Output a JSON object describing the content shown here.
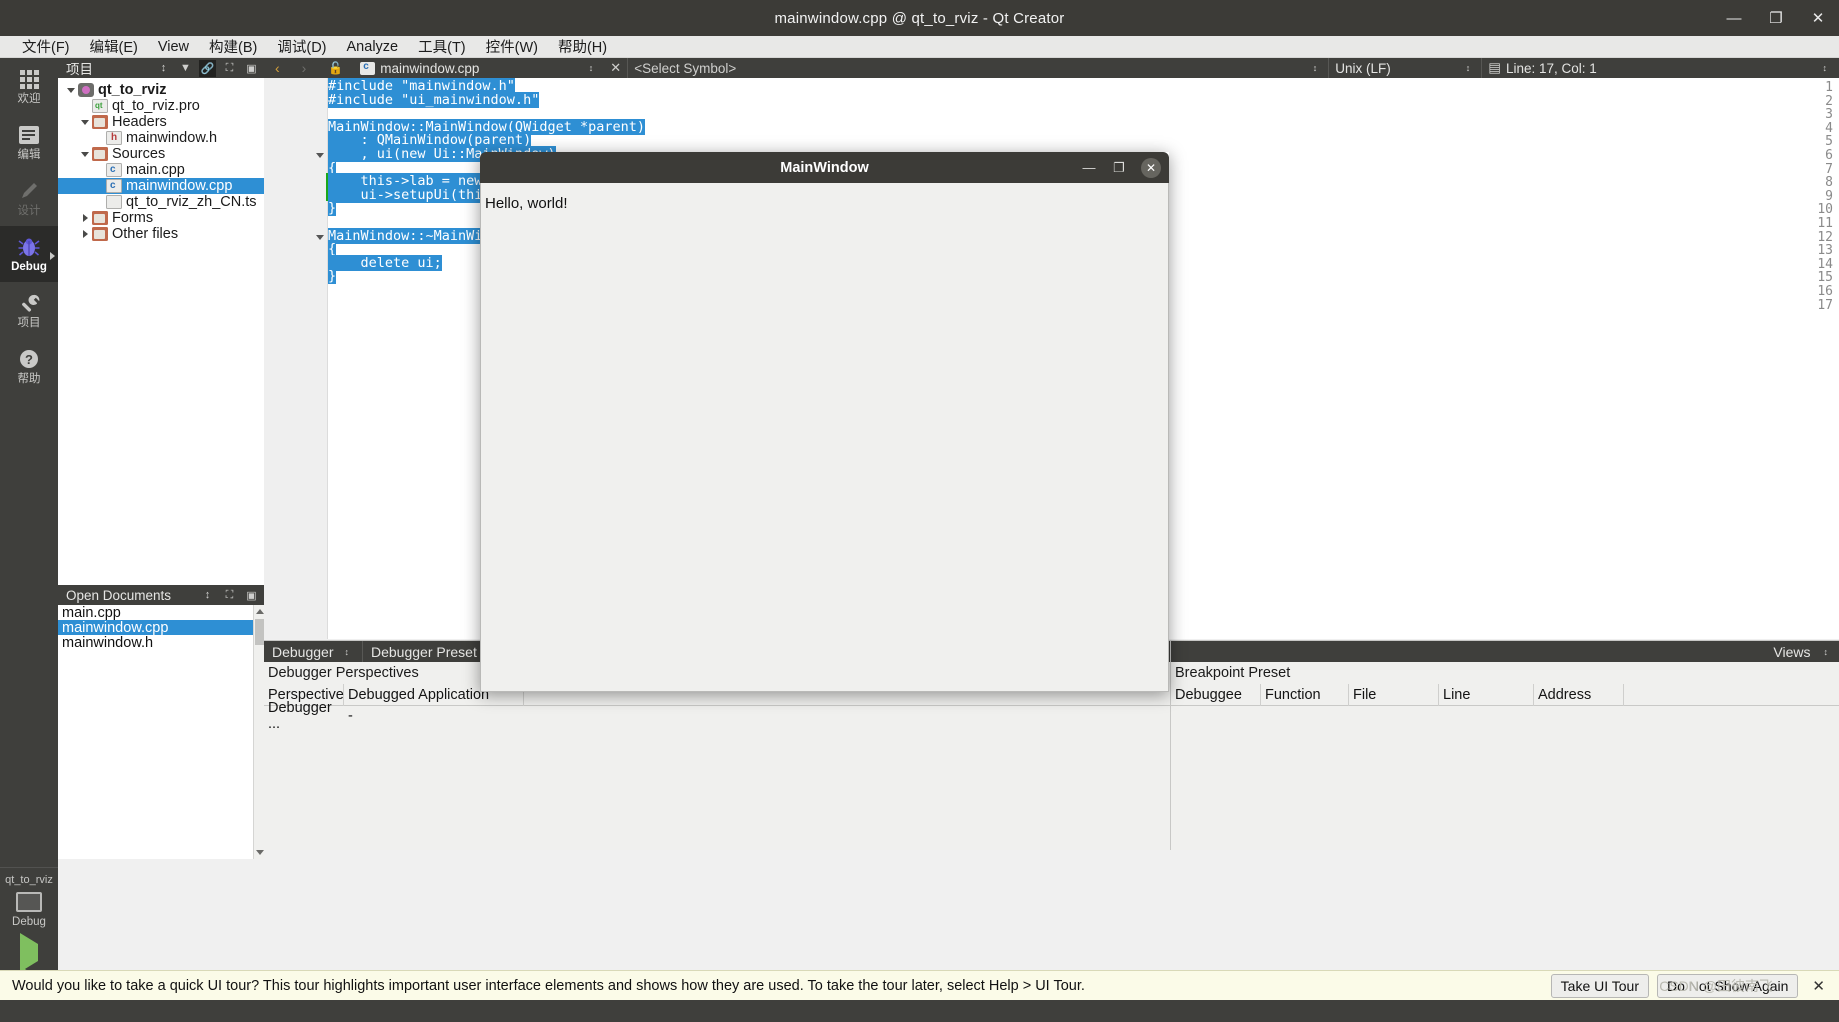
{
  "window": {
    "title": "mainwindow.cpp @ qt_to_rviz - Qt Creator",
    "minimize": "—",
    "maximize": "❐",
    "close": "✕"
  },
  "menubar": {
    "items": [
      {
        "label": "文件(F)",
        "mnemonic": "F"
      },
      {
        "label": "编辑(E)",
        "mnemonic": "E"
      },
      {
        "label": "View",
        "mnemonic": "V"
      },
      {
        "label": "构建(B)",
        "mnemonic": "B"
      },
      {
        "label": "调试(D)",
        "mnemonic": "D"
      },
      {
        "label": "Analyze",
        "mnemonic": "A"
      },
      {
        "label": "工具(T)",
        "mnemonic": "T"
      },
      {
        "label": "控件(W)",
        "mnemonic": "W"
      },
      {
        "label": "帮助(H)",
        "mnemonic": "H"
      }
    ]
  },
  "modebar": {
    "modes": [
      {
        "label": "欢迎",
        "icon": "grid-icon",
        "state": "normal"
      },
      {
        "label": "编辑",
        "icon": "editor-icon",
        "state": "normal"
      },
      {
        "label": "设计",
        "icon": "pencil-icon",
        "state": "disabled"
      },
      {
        "label": "Debug",
        "icon": "bug-icon",
        "state": "active"
      },
      {
        "label": "项目",
        "icon": "wrench-icon",
        "state": "normal"
      },
      {
        "label": "帮助",
        "icon": "question-icon",
        "state": "normal"
      }
    ],
    "kit": {
      "project": "qt_to_rviz",
      "build_config": "Debug"
    },
    "run_label": "run-button",
    "debug_label": "run-debug-button"
  },
  "project_panel": {
    "title": "项目",
    "tools": [
      "sort-toggle",
      "filter-icon",
      "link-with-editor-icon",
      "add-split-icon",
      "collapse-icon"
    ],
    "tree": [
      {
        "indent": 0,
        "twisty": "down",
        "icon": "proj",
        "label": "qt_to_rviz",
        "bold": true,
        "selected": false
      },
      {
        "indent": 1,
        "twisty": "none",
        "icon": "pro",
        "label": "qt_to_rviz.pro",
        "bold": false,
        "selected": false
      },
      {
        "indent": 1,
        "twisty": "down",
        "icon": "folder",
        "label": "Headers",
        "bold": false,
        "selected": false
      },
      {
        "indent": 2,
        "twisty": "none",
        "icon": "h",
        "label": "mainwindow.h",
        "bold": false,
        "selected": false
      },
      {
        "indent": 1,
        "twisty": "down",
        "icon": "folder",
        "label": "Sources",
        "bold": false,
        "selected": false
      },
      {
        "indent": 2,
        "twisty": "none",
        "icon": "cpp",
        "label": "main.cpp",
        "bold": false,
        "selected": false
      },
      {
        "indent": 2,
        "twisty": "none",
        "icon": "cpp",
        "label": "mainwindow.cpp",
        "bold": false,
        "selected": true
      },
      {
        "indent": 2,
        "twisty": "none",
        "icon": "file",
        "label": "qt_to_rviz_zh_CN.ts",
        "bold": false,
        "selected": false
      },
      {
        "indent": 1,
        "twisty": "right",
        "icon": "folder",
        "label": "Forms",
        "bold": false,
        "selected": false
      },
      {
        "indent": 1,
        "twisty": "right",
        "icon": "folder",
        "label": "Other files",
        "bold": false,
        "selected": false
      }
    ]
  },
  "open_documents": {
    "title": "Open Documents",
    "tools": [
      "sort-toggle",
      "add-split-icon",
      "collapse-icon"
    ],
    "items": [
      {
        "label": "main.cpp",
        "selected": false
      },
      {
        "label": "mainwindow.cpp",
        "selected": true
      },
      {
        "label": "mainwindow.h",
        "selected": false
      }
    ]
  },
  "editor_toolbar": {
    "back": "‹",
    "forward": "›",
    "lock": "lock-open-icon",
    "file_name": "mainwindow.cpp",
    "symbol_selector": "<Select Symbol>",
    "line_ending": "Unix (LF)",
    "cursor_position": "Line: 17, Col: 1",
    "close_doc": "✕"
  },
  "code": {
    "file": "mainwindow.cpp",
    "selected_all": true,
    "cursor_lines": [
      8,
      9
    ],
    "fold_lines": [
      6,
      12
    ],
    "lines": [
      {
        "n": 1,
        "text": "#include \"mainwindow.h\""
      },
      {
        "n": 2,
        "text": "#include \"ui_mainwindow.h\""
      },
      {
        "n": 3,
        "text": ""
      },
      {
        "n": 4,
        "text": "MainWindow::MainWindow(QWidget *parent)"
      },
      {
        "n": 5,
        "text": "    : QMainWindow(parent)"
      },
      {
        "n": 6,
        "text": "    , ui(new Ui::MainWindow)"
      },
      {
        "n": 7,
        "text": "{"
      },
      {
        "n": 8,
        "text": "    this->lab = new QLabel("
      },
      {
        "n": 9,
        "text": "    ui->setupUi(this);"
      },
      {
        "n": 10,
        "text": "}"
      },
      {
        "n": 11,
        "text": ""
      },
      {
        "n": 12,
        "text": "MainWindow::~MainWindow()"
      },
      {
        "n": 13,
        "text": "{"
      },
      {
        "n": 14,
        "text": "    delete ui;"
      },
      {
        "n": 15,
        "text": "}"
      },
      {
        "n": 16,
        "text": ""
      },
      {
        "n": 17,
        "text": ""
      }
    ]
  },
  "dialog": {
    "title": "MainWindow",
    "minimize": "—",
    "maximize": "❐",
    "close": "✕",
    "content_label": "Hello, world!"
  },
  "debugger_panel": {
    "tab_left": "Debugger",
    "tab_right": "Debugger Preset",
    "section_title": "Debugger Perspectives",
    "columns": [
      "Perspective",
      "Debugged Application"
    ],
    "rows": [
      {
        "perspective": "Debugger ...",
        "application": "-"
      }
    ]
  },
  "breakpoint_panel": {
    "views_label": "Views",
    "section_title": "Breakpoint Preset",
    "columns": [
      "Debuggee",
      "Function",
      "File",
      "Line",
      "Address"
    ],
    "rows": []
  },
  "tour_bar": {
    "message": "Would you like to take a quick UI tour? This tour highlights important user interface elements and shows how they are used. To take the tour later, select Help > UI Tour.",
    "take_tour": "Take UI Tour",
    "dismiss": "Do Not Show Again",
    "close": "✕"
  },
  "watermark": "CSDN @田彼南飞",
  "colors": {
    "selection_blue": "#2e8fd4",
    "dark_chrome": "#3f3f3c",
    "titlebar": "#3c3b37",
    "tour_bg": "#fbfbe8",
    "run_green": "#7fbf5f"
  }
}
